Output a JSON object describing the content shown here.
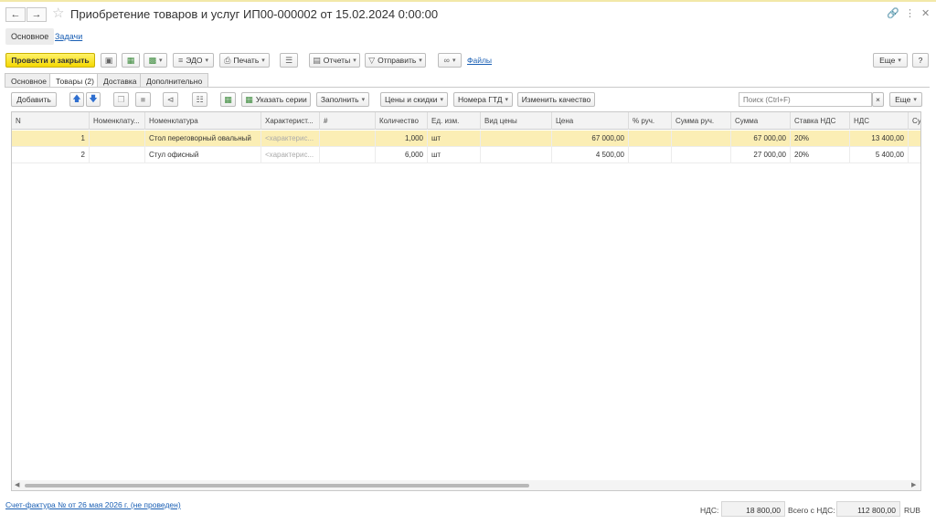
{
  "window": {
    "title": "Приобретение товаров и услуг ИП00-000002 от 15.02.2024 0:00:00"
  },
  "top_tabs": {
    "main": "Основное",
    "tasks": "Задачи"
  },
  "toolbar": {
    "post_close": "Провести и закрыть",
    "edo": "ЭДО",
    "print": "Печать",
    "reports": "Отчеты",
    "send": "Отправить",
    "files": "Файлы",
    "more": "Еще",
    "help": "?"
  },
  "doc_tabs": [
    "Основное",
    "Товары (2)",
    "Доставка",
    "Дополнительно"
  ],
  "goods_toolbar": {
    "add": "Добавить",
    "series": "Указать серии",
    "fill": "Заполнить",
    "prices": "Цены и скидки",
    "gtd": "Номера ГТД",
    "quality": "Изменить качество",
    "search_placeholder": "Поиск (Ctrl+F)",
    "more": "Еще"
  },
  "table": {
    "headers": {
      "n": "N",
      "nom_short": "Номенклату...",
      "nom": "Номенклатура",
      "char": "Характерист...",
      "hash": "#",
      "qty": "Количество",
      "unit": "Ед. изм.",
      "price_type": "Вид цены",
      "price": "Цена",
      "pct": "% руч.",
      "sum_manual": "Сумма руч.",
      "sum": "Сумма",
      "vat_rate": "Ставка НДС",
      "vat": "НДС",
      "extra": "Су"
    },
    "rows": [
      {
        "n": "1",
        "nom": "Стол переговорный овальный",
        "char": "<характерис...",
        "qty": "1,000",
        "unit": "шт",
        "price": "67 000,00",
        "sum": "67 000,00",
        "vat_rate": "20%",
        "vat": "13 400,00"
      },
      {
        "n": "2",
        "nom": "Стул офисный",
        "char": "<характерис...",
        "qty": "6,000",
        "unit": "шт",
        "price": "4 500,00",
        "sum": "27 000,00",
        "vat_rate": "20%",
        "vat": "5 400,00"
      }
    ]
  },
  "footer": {
    "invoice_link": "Счет-фактура №  от 26 мая 2026 г. (не проведен)",
    "vat_label": "НДС:",
    "vat_value": "18 800,00",
    "total_label": "Всего с НДС:",
    "total_value": "112 800,00",
    "currency": "RUB"
  }
}
